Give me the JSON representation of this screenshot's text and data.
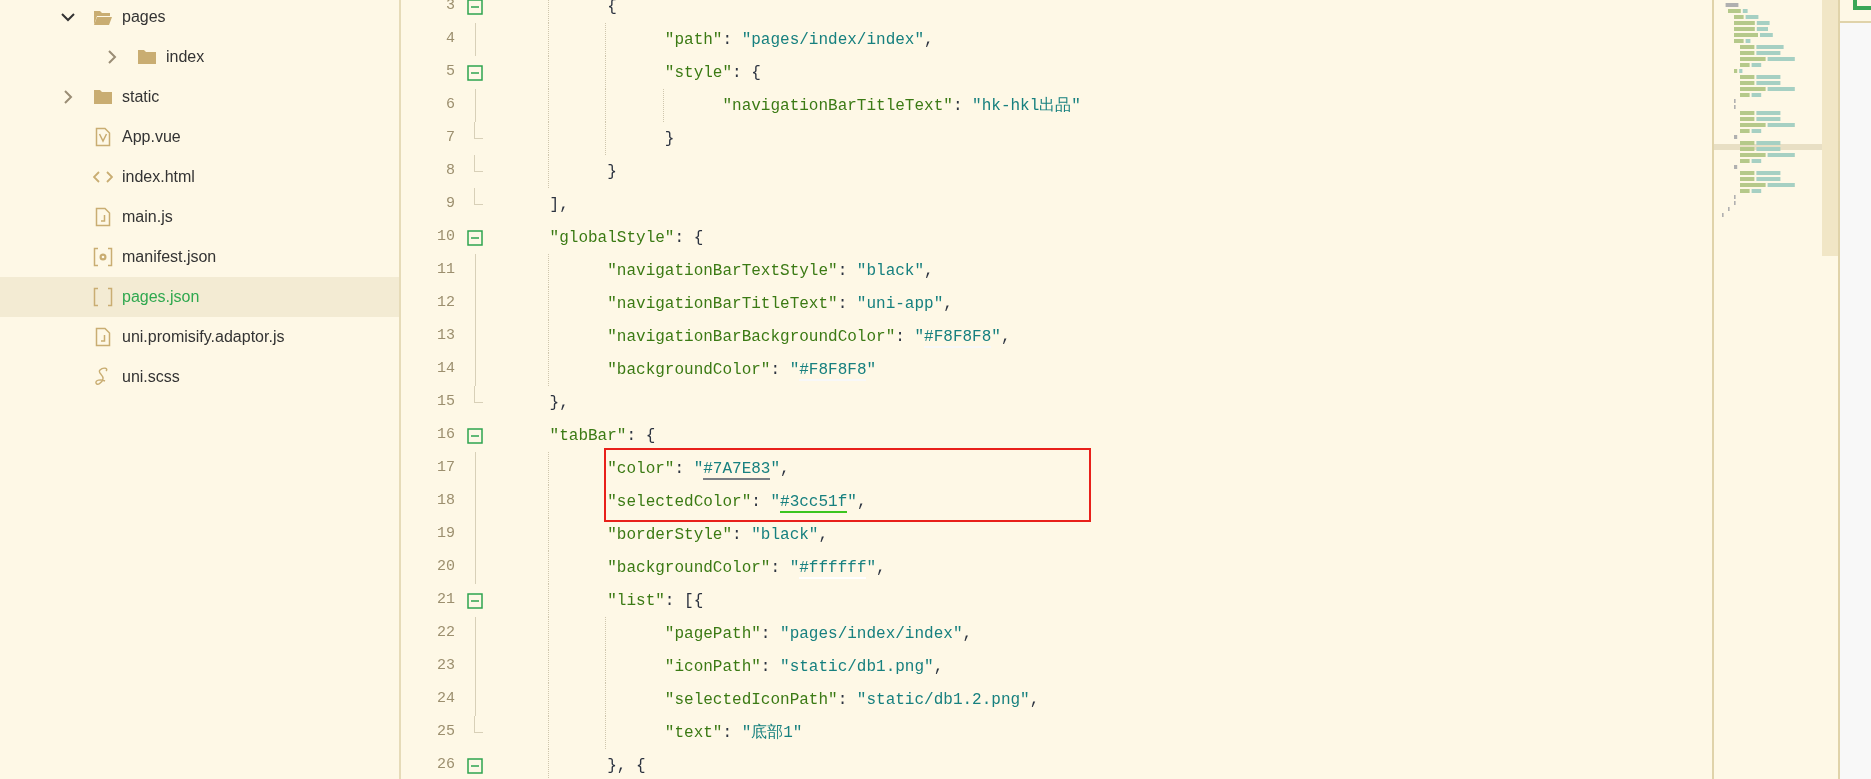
{
  "file_tree": [
    {
      "kind": "folder",
      "name": "pages",
      "expanded": true,
      "selected": false,
      "children": [
        {
          "kind": "folder",
          "name": "index",
          "expanded": false,
          "selected": false
        }
      ]
    },
    {
      "kind": "folder",
      "name": "static",
      "expanded": false,
      "selected": false
    },
    {
      "kind": "vue",
      "name": "App.vue",
      "selected": false
    },
    {
      "kind": "html",
      "name": "index.html",
      "selected": false
    },
    {
      "kind": "js",
      "name": "main.js",
      "selected": false
    },
    {
      "kind": "manifest",
      "name": "manifest.json",
      "selected": false
    },
    {
      "kind": "json",
      "name": "pages.json",
      "selected": true
    },
    {
      "kind": "js",
      "name": "uni.promisify.adaptor.js",
      "selected": false
    },
    {
      "kind": "scss",
      "name": "uni.scss",
      "selected": false
    }
  ],
  "lines": [
    {
      "number": "3",
      "kind": "fold_start",
      "tokens": [
        {
          "kind": "punct",
          "text": "            {"
        }
      ]
    },
    {
      "number": "4",
      "kind": "fold_body",
      "tokens": [
        {
          "kind": "key",
          "text": "                  \"path\""
        },
        {
          "kind": "punct",
          "text": ": "
        },
        {
          "kind": "string",
          "text": "\"pages/index/index\""
        },
        {
          "kind": "punct",
          "text": ","
        }
      ]
    },
    {
      "number": "5",
      "kind": "fold_start",
      "tokens": [
        {
          "kind": "key",
          "text": "                  \"style\""
        },
        {
          "kind": "punct",
          "text": ": {"
        }
      ]
    },
    {
      "number": "6",
      "kind": "fold_body",
      "tokens": [
        {
          "kind": "key",
          "text": "                        \"navigationBarTitleText\""
        },
        {
          "kind": "punct",
          "text": ": "
        },
        {
          "kind": "string",
          "text": "\"hk-hkl出品\""
        }
      ]
    },
    {
      "number": "7",
      "kind": "fold_end",
      "tokens": [
        {
          "kind": "punct",
          "text": "                  }"
        }
      ]
    },
    {
      "number": "8",
      "kind": "fold_end",
      "tokens": [
        {
          "kind": "punct",
          "text": "            }"
        }
      ]
    },
    {
      "number": "9",
      "kind": "fold_end",
      "tokens": [
        {
          "kind": "punct",
          "text": "      ],"
        }
      ]
    },
    {
      "number": "10",
      "kind": "fold_start",
      "tokens": [
        {
          "kind": "key",
          "text": "      \"globalStyle\""
        },
        {
          "kind": "punct",
          "text": ": {"
        }
      ]
    },
    {
      "number": "11",
      "kind": "fold_body",
      "tokens": [
        {
          "kind": "key",
          "text": "            \"navigationBarTextStyle\""
        },
        {
          "kind": "punct",
          "text": ": "
        },
        {
          "kind": "string",
          "text": "\"black\""
        },
        {
          "kind": "punct",
          "text": ","
        }
      ]
    },
    {
      "number": "12",
      "kind": "fold_body",
      "tokens": [
        {
          "kind": "key",
          "text": "            \"navigationBarTitleText\""
        },
        {
          "kind": "punct",
          "text": ": "
        },
        {
          "kind": "string",
          "text": "\"uni-app\""
        },
        {
          "kind": "punct",
          "text": ","
        }
      ]
    },
    {
      "number": "13",
      "kind": "fold_body",
      "tokens": [
        {
          "kind": "key",
          "text": "            \"navigationBarBackgroundColor\""
        },
        {
          "kind": "punct",
          "text": ": "
        },
        {
          "kind": "string",
          "text": "\""
        },
        {
          "kind": "swatch",
          "text": "#F8F8F8",
          "color": "#f8f8f8"
        },
        {
          "kind": "string",
          "text": "\""
        },
        {
          "kind": "punct",
          "text": ","
        }
      ]
    },
    {
      "number": "14",
      "kind": "fold_body",
      "tokens": [
        {
          "kind": "key",
          "text": "            \"backgroundColor\""
        },
        {
          "kind": "punct",
          "text": ": "
        },
        {
          "kind": "string",
          "text": "\""
        },
        {
          "kind": "swatch",
          "text": "#F8F8F8",
          "color": "#f8f8f8"
        },
        {
          "kind": "string",
          "text": "\""
        }
      ]
    },
    {
      "number": "15",
      "kind": "fold_end",
      "tokens": [
        {
          "kind": "punct",
          "text": "      },"
        }
      ]
    },
    {
      "number": "16",
      "kind": "fold_start",
      "tokens": [
        {
          "kind": "key",
          "text": "      \"tabBar\""
        },
        {
          "kind": "punct",
          "text": ": {"
        }
      ]
    },
    {
      "kind": "highlight_box",
      "color": "#e8201a",
      "lines": [
        {
          "number": "17",
          "kind": "fold_body",
          "tokens": [
            {
              "kind": "key",
              "text": "            \"color\""
            },
            {
              "kind": "punct",
              "text": ": "
            },
            {
              "kind": "string",
              "text": "\""
            },
            {
              "kind": "swatch",
              "text": "#7A7E83",
              "color": "#7a7e83"
            },
            {
              "kind": "string",
              "text": "\""
            },
            {
              "kind": "punct",
              "text": ","
            }
          ]
        },
        {
          "number": "18",
          "kind": "fold_body",
          "tokens": [
            {
              "kind": "key",
              "text": "            \"selectedColor\""
            },
            {
              "kind": "punct",
              "text": ": "
            },
            {
              "kind": "string",
              "text": "\""
            },
            {
              "kind": "swatch",
              "text": "#3cc51f",
              "color": "#3cc51f"
            },
            {
              "kind": "string",
              "text": "\""
            },
            {
              "kind": "punct",
              "text": ","
            }
          ]
        }
      ]
    },
    {
      "number": "19",
      "kind": "fold_body",
      "tokens": [
        {
          "kind": "key",
          "text": "            \"borderStyle\""
        },
        {
          "kind": "punct",
          "text": ": "
        },
        {
          "kind": "string",
          "text": "\"black\""
        },
        {
          "kind": "punct",
          "text": ","
        }
      ]
    },
    {
      "number": "20",
      "kind": "fold_body",
      "tokens": [
        {
          "kind": "key",
          "text": "            \"backgroundColor\""
        },
        {
          "kind": "punct",
          "text": ": "
        },
        {
          "kind": "string",
          "text": "\""
        },
        {
          "kind": "swatch",
          "text": "#ffffff",
          "color": "#ffffff"
        },
        {
          "kind": "string",
          "text": "\""
        },
        {
          "kind": "punct",
          "text": ","
        }
      ]
    },
    {
      "number": "21",
      "kind": "fold_start",
      "tokens": [
        {
          "kind": "key",
          "text": "            \"list\""
        },
        {
          "kind": "punct",
          "text": ": [{"
        }
      ]
    },
    {
      "number": "22",
      "kind": "fold_body",
      "tokens": [
        {
          "kind": "key",
          "text": "                  \"pagePath\""
        },
        {
          "kind": "punct",
          "text": ": "
        },
        {
          "kind": "string",
          "text": "\"pages/index/index\""
        },
        {
          "kind": "punct",
          "text": ","
        }
      ]
    },
    {
      "number": "23",
      "kind": "fold_body",
      "tokens": [
        {
          "kind": "key",
          "text": "                  \"iconPath\""
        },
        {
          "kind": "punct",
          "text": ": "
        },
        {
          "kind": "string",
          "text": "\"static/db1.png\""
        },
        {
          "kind": "punct",
          "text": ","
        }
      ]
    },
    {
      "number": "24",
      "kind": "fold_body",
      "tokens": [
        {
          "kind": "key",
          "text": "                  \"selectedIconPath\""
        },
        {
          "kind": "punct",
          "text": ": "
        },
        {
          "kind": "string",
          "text": "\"static/db1.2.png\""
        },
        {
          "kind": "punct",
          "text": ","
        }
      ]
    },
    {
      "number": "25",
      "kind": "fold_end",
      "tokens": [
        {
          "kind": "key",
          "text": "                  \"text\""
        },
        {
          "kind": "punct",
          "text": ": "
        },
        {
          "kind": "string",
          "text": "\"底部1\""
        }
      ]
    },
    {
      "number": "26",
      "kind": "fold_start",
      "tokens": [
        {
          "kind": "punct",
          "text": "            }, {"
        }
      ]
    }
  ]
}
